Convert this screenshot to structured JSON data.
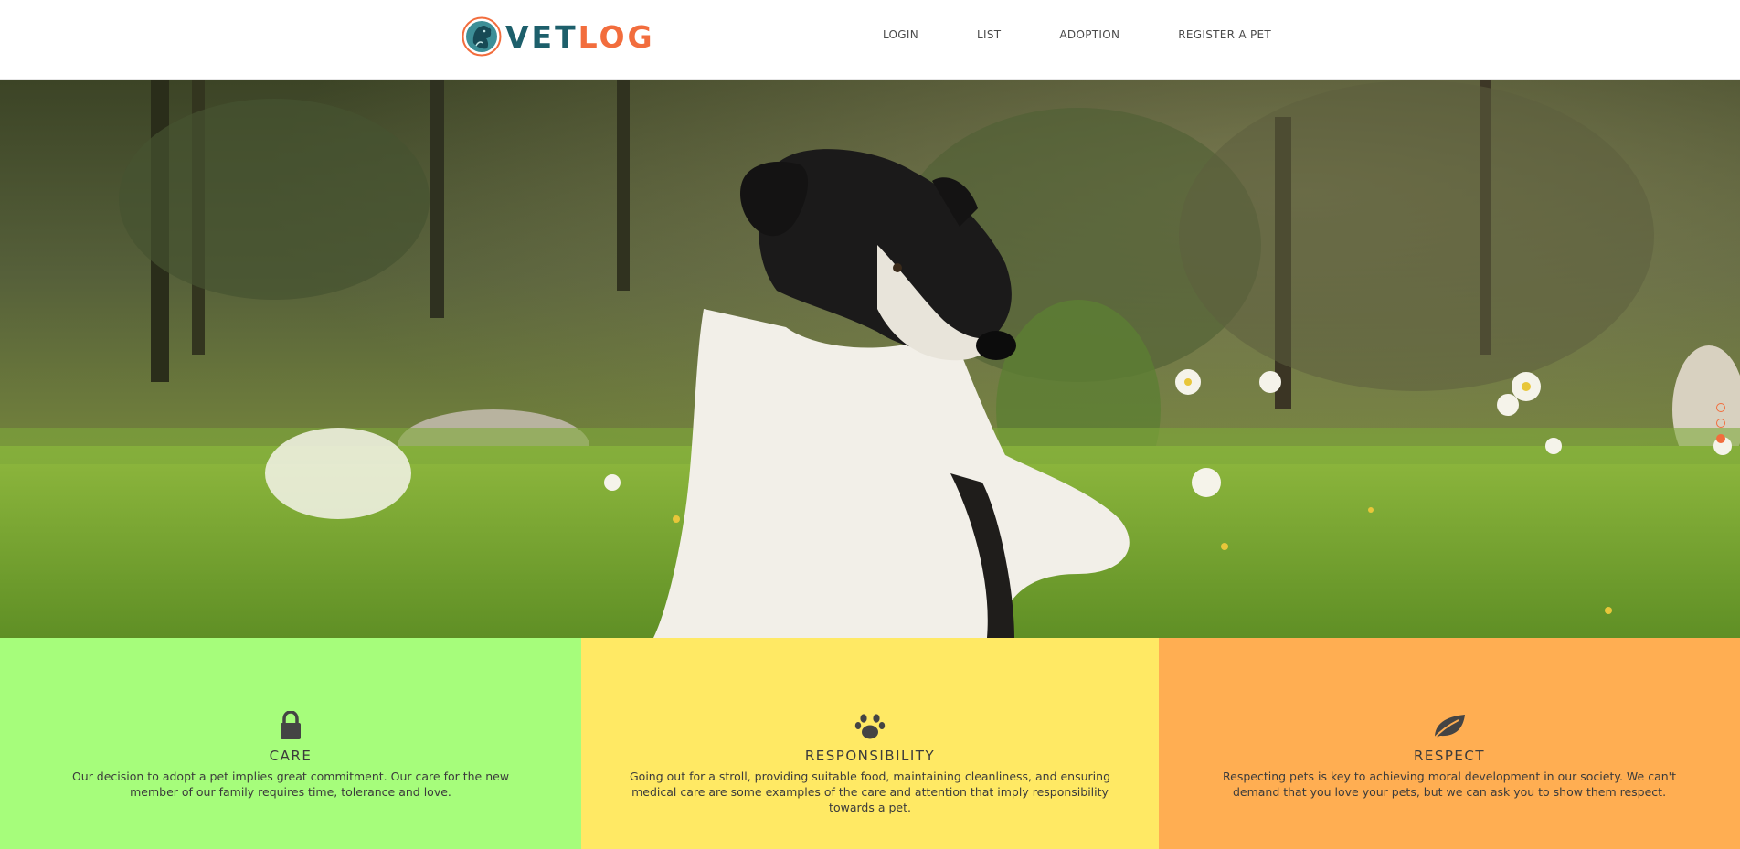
{
  "brand": {
    "logo_part1": "VET",
    "logo_part2": "LOG",
    "colors": {
      "teal": "#1d5f6b",
      "orange": "#f26d3d"
    }
  },
  "nav": {
    "items": [
      {
        "label": "LOGIN"
      },
      {
        "label": "LIST"
      },
      {
        "label": "ADOPTION"
      },
      {
        "label": "REGISTER A PET"
      }
    ]
  },
  "hero": {
    "image_subject": "black-and-white dog lying in grass with daisies",
    "slides_total": 3,
    "active_slide": 3
  },
  "features": [
    {
      "icon": "lock-icon",
      "title": "CARE",
      "text": "Our decision to adopt a pet implies great commitment. Our care for the new member of our family requires time, tolerance and love.",
      "color": "#a6fd7b"
    },
    {
      "icon": "paw-icon",
      "title": "RESPONSIBILITY",
      "text": "Going out for a stroll, providing suitable food, maintaining cleanliness, and ensuring medical care are some examples of the care and attention that imply responsibility towards a pet.",
      "color": "#ffe964"
    },
    {
      "icon": "leaf-icon",
      "title": "RESPECT",
      "text": "Respecting pets is key to achieving moral development in our society. We can't demand that you love your pets, but we can ask you to show them respect.",
      "color": "#ffae52"
    }
  ]
}
